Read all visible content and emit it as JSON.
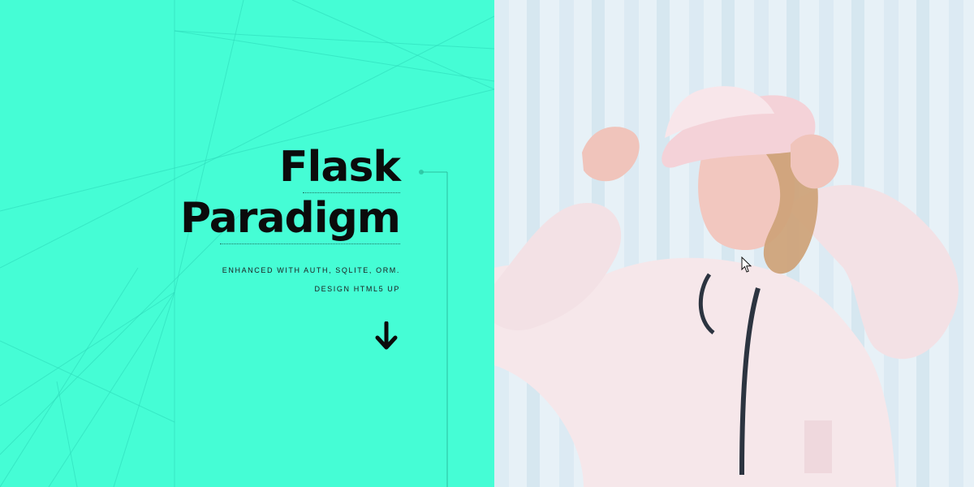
{
  "hero": {
    "title_line1": "Flask",
    "title_line2": "Paradigm",
    "subtitle": "ENHANCED WITH AUTH, SQLITE, ORM.",
    "credit": "DESIGN HTML5 UP"
  },
  "icons": {
    "scroll_down": "arrow-down-icon",
    "cursor": "mouse-pointer-icon"
  },
  "colors": {
    "accent": "#45fdd5",
    "text": "#0b0b0b",
    "photo_background": "#eaf3f8"
  }
}
